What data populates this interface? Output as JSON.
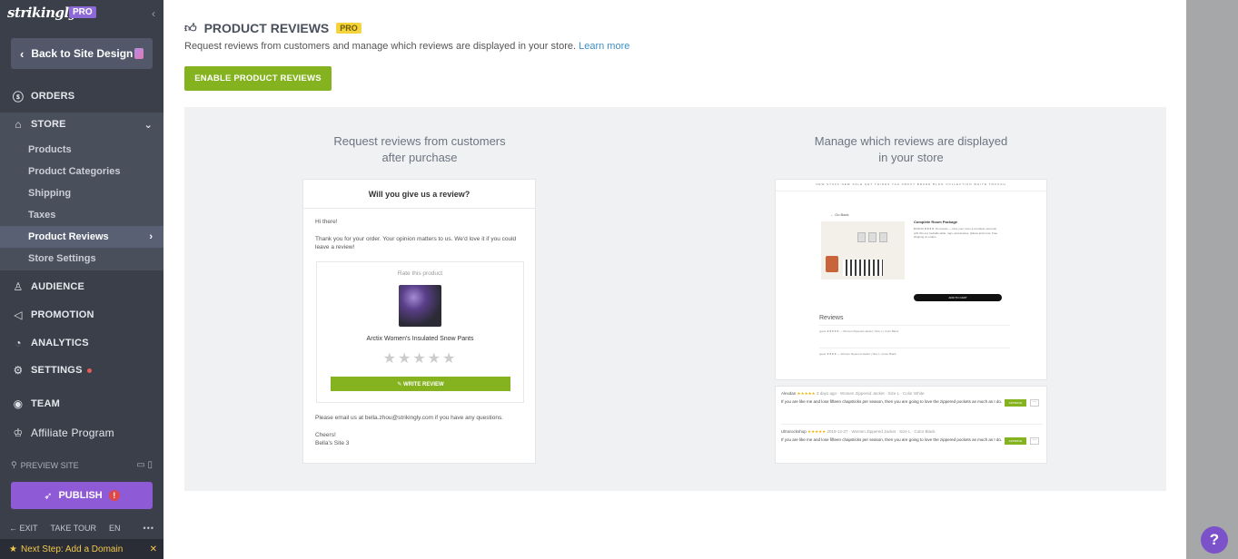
{
  "sidebar": {
    "logo": "strikingly",
    "pro_badge": "PRO",
    "back_label": "Back to Site Design",
    "nav": {
      "orders": "ORDERS",
      "store": "STORE",
      "audience": "AUDIENCE",
      "promotion": "PROMOTION",
      "analytics": "ANALYTICS",
      "settings": "SETTINGS",
      "team": "TEAM",
      "affiliate": "Affiliate Program"
    },
    "store_items": [
      "Products",
      "Product Categories",
      "Shipping",
      "Taxes",
      "Product Reviews",
      "Store Settings"
    ],
    "preview_label": "PREVIEW SITE",
    "publish_label": "PUBLISH",
    "bottom": {
      "exit": "EXIT",
      "take_tour": "TAKE TOUR",
      "lang": "EN",
      "more": "•••"
    },
    "next_step": "Next Step: Add a Domain",
    "close": "✕"
  },
  "main": {
    "title": "PRODUCT REVIEWS",
    "pro_badge": "PRO",
    "description": "Request reviews from customers and manage which reviews are displayed in your store.",
    "learn_more": "Learn more",
    "enable_button": "ENABLE PRODUCT REVIEWS",
    "left_caption_1": "Request reviews from customers",
    "left_caption_2": "after purchase",
    "right_caption_1": "Manage which reviews are displayed",
    "right_caption_2": "in your store",
    "email": {
      "heading": "Will you give us a review?",
      "greeting": "Hi there!",
      "body": "Thank you for your order. Your opinion matters to us. We'd love it if you could leave a review!",
      "rate_label": "Rate this product",
      "product_name": "Arctix Women's Insulated Snow Pants",
      "stars": "★★★★★",
      "write_review": "✎ WRITE REVIEW",
      "footer": "Please email us at bella.zhou@strikingly.com if you have any questions.",
      "cheers": "Cheers!",
      "signature": "Bella's Site 3"
    },
    "store_preview": {
      "nav": "NEW STUFF   NEW SALE   GET THINGS   TAG   ABOUT BRAND   BLOG   COLLECTION   WHITE TROUGH",
      "back": "← Go Back",
      "product_title": "Complete Room Package",
      "product_details": "$149.00 ★★★★ 16 reviews — Give your room a complete new look with this set: bedside table, rugs, accessories, pillows and more. Free shipping on orders.",
      "add_to_cart": "ADD TO CART",
      "reviews_heading": "Reviews",
      "review_line_1": "guest ★★★★★ — Women Zippered Jacket | Size L | Color Black",
      "review_line_2": "guest ★★★★ — Women Zippered Jacket | Size L | Color Black"
    },
    "review_list": [
      {
        "name": "Alexdan",
        "stars": "★★★★★",
        "meta": "3 days ago · Women Zippered Jacket · Size L · Color White",
        "body": "If you are like me and lose fifteen chapsticks per season, then you are going to love the zippered pockets as much as I do.",
        "approve": "APPROVE",
        "more": "···"
      },
      {
        "name": "Ultrarockshop",
        "stars": "★★★★★",
        "meta": "2019-12-27 · Women Zippered Jacket · Size L · Color Black",
        "body": "If you are like me and lose fifteen chapsticks per season, then you are going to love the zippered pockets as much as I do.",
        "approve": "APPROVE",
        "more": "···"
      }
    ]
  },
  "help": "?"
}
